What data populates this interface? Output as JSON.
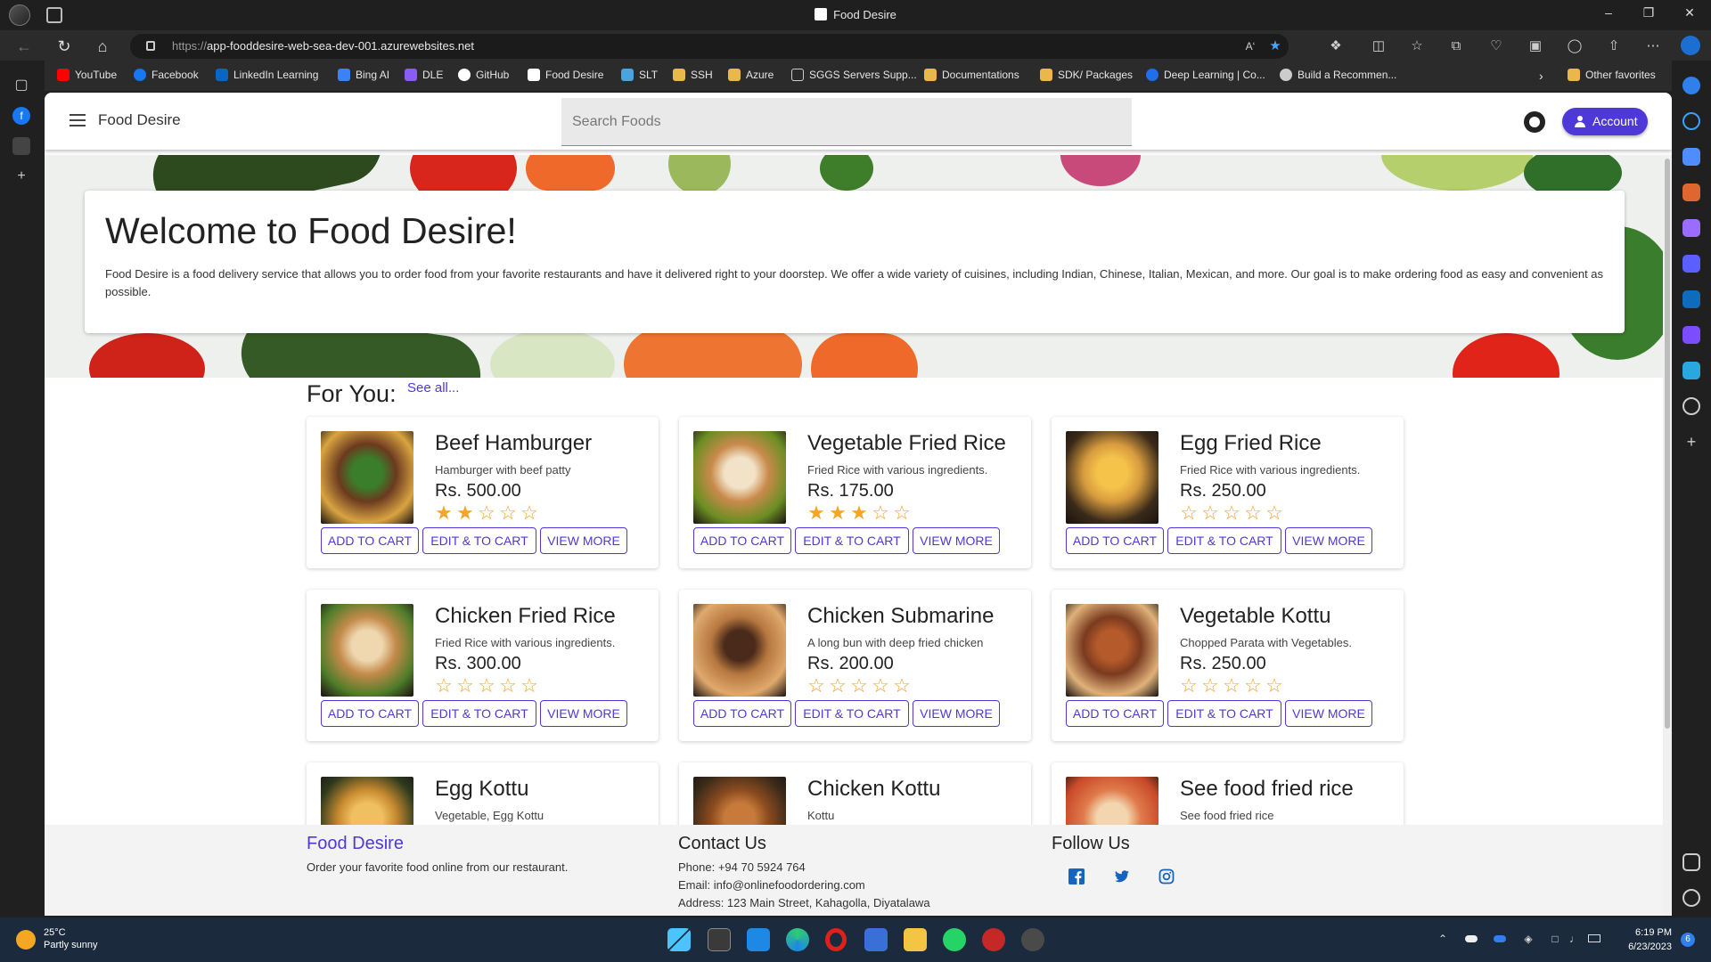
{
  "browser": {
    "tab_title": "Food Desire",
    "url_protocol": "https://",
    "url_host": "app-fooddesire-web-sea-dev-001.azurewebsites.net",
    "favorites": [
      {
        "label": "YouTube",
        "color": "#ff0000"
      },
      {
        "label": "Facebook",
        "color": "#1877f2"
      },
      {
        "label": "LinkedIn Learning",
        "color": "#0a66c2"
      },
      {
        "label": "Bing AI",
        "color": "#3b82f6"
      },
      {
        "label": "DLE",
        "color": "#8a5cf6"
      },
      {
        "label": "GitHub",
        "color": "#ffffff"
      },
      {
        "label": "Food Desire",
        "color": "#ffffff"
      },
      {
        "label": "SLT",
        "color": "#4aa3df"
      },
      {
        "label": "SSH",
        "color": "#e8b84a"
      },
      {
        "label": "Azure",
        "color": "#e8b84a"
      },
      {
        "label": "SGGS Servers Supp...",
        "color": "#cccccc"
      },
      {
        "label": "Documentations",
        "color": "#e8b84a"
      },
      {
        "label": "SDK/ Packages",
        "color": "#e8b84a"
      },
      {
        "label": "Deep Learning | Co...",
        "color": "#1f6feb"
      },
      {
        "label": "Build a Recommen...",
        "color": "#cccccc"
      }
    ],
    "other_favorites": "Other favorites"
  },
  "app": {
    "brand": "Food Desire",
    "search_placeholder": "Search Foods",
    "account_label": "Account",
    "accent_color": "#4f38d8"
  },
  "hero": {
    "title": "Welcome to Food Desire!",
    "text": "Food Desire is a food delivery service that allows you to order food from your favorite restaurants and have it delivered right to your doorstep. We offer a wide variety of cuisines, including Indian, Chinese, Italian, Mexican, and more. Our goal is to make ordering food as easy and convenient as possible."
  },
  "section": {
    "title": "For You:",
    "see_all": "See all..."
  },
  "buttons": {
    "add": "ADD TO CART",
    "edit": "EDIT & TO CART",
    "view": "VIEW MORE"
  },
  "foods": [
    {
      "name": "Beef Hamburger",
      "desc": "Hamburger with beef patty",
      "price": "Rs. 500.00",
      "rating": 2
    },
    {
      "name": "Vegetable Fried Rice",
      "desc": "Fried Rice with various ingredients.",
      "price": "Rs. 175.00",
      "rating": 3
    },
    {
      "name": "Egg Fried Rice",
      "desc": "Fried Rice with various ingredients.",
      "price": "Rs. 250.00",
      "rating": 0
    },
    {
      "name": "Chicken Fried Rice",
      "desc": "Fried Rice with various ingredients.",
      "price": "Rs. 300.00",
      "rating": 0
    },
    {
      "name": "Chicken Submarine",
      "desc": "A long bun with deep fried chicken",
      "price": "Rs. 200.00",
      "rating": 0
    },
    {
      "name": "Vegetable Kottu",
      "desc": "Chopped Parata with Vegetables.",
      "price": "Rs. 250.00",
      "rating": 0
    },
    {
      "name": "Egg Kottu",
      "desc": "Vegetable, Egg Kottu",
      "price": "",
      "rating": 0
    },
    {
      "name": "Chicken Kottu",
      "desc": "Kottu",
      "price": "",
      "rating": 0
    },
    {
      "name": "See food fried rice",
      "desc": "See food fried rice",
      "price": "",
      "rating": 0
    }
  ],
  "footer": {
    "brand": "Food Desire",
    "tagline": "Order your favorite food online from our restaurant.",
    "contact_title": "Contact Us",
    "phone": "Phone: +94 70 5924 764",
    "email": "Email: info@onlinefoodordering.com",
    "address": "Address: 123 Main Street, Kahagolla, Diyatalawa",
    "follow_title": "Follow Us"
  },
  "taskbar": {
    "temp": "25°C",
    "weather": "Partly sunny",
    "time": "6:19 PM",
    "date": "6/23/2023",
    "badge": "6"
  }
}
